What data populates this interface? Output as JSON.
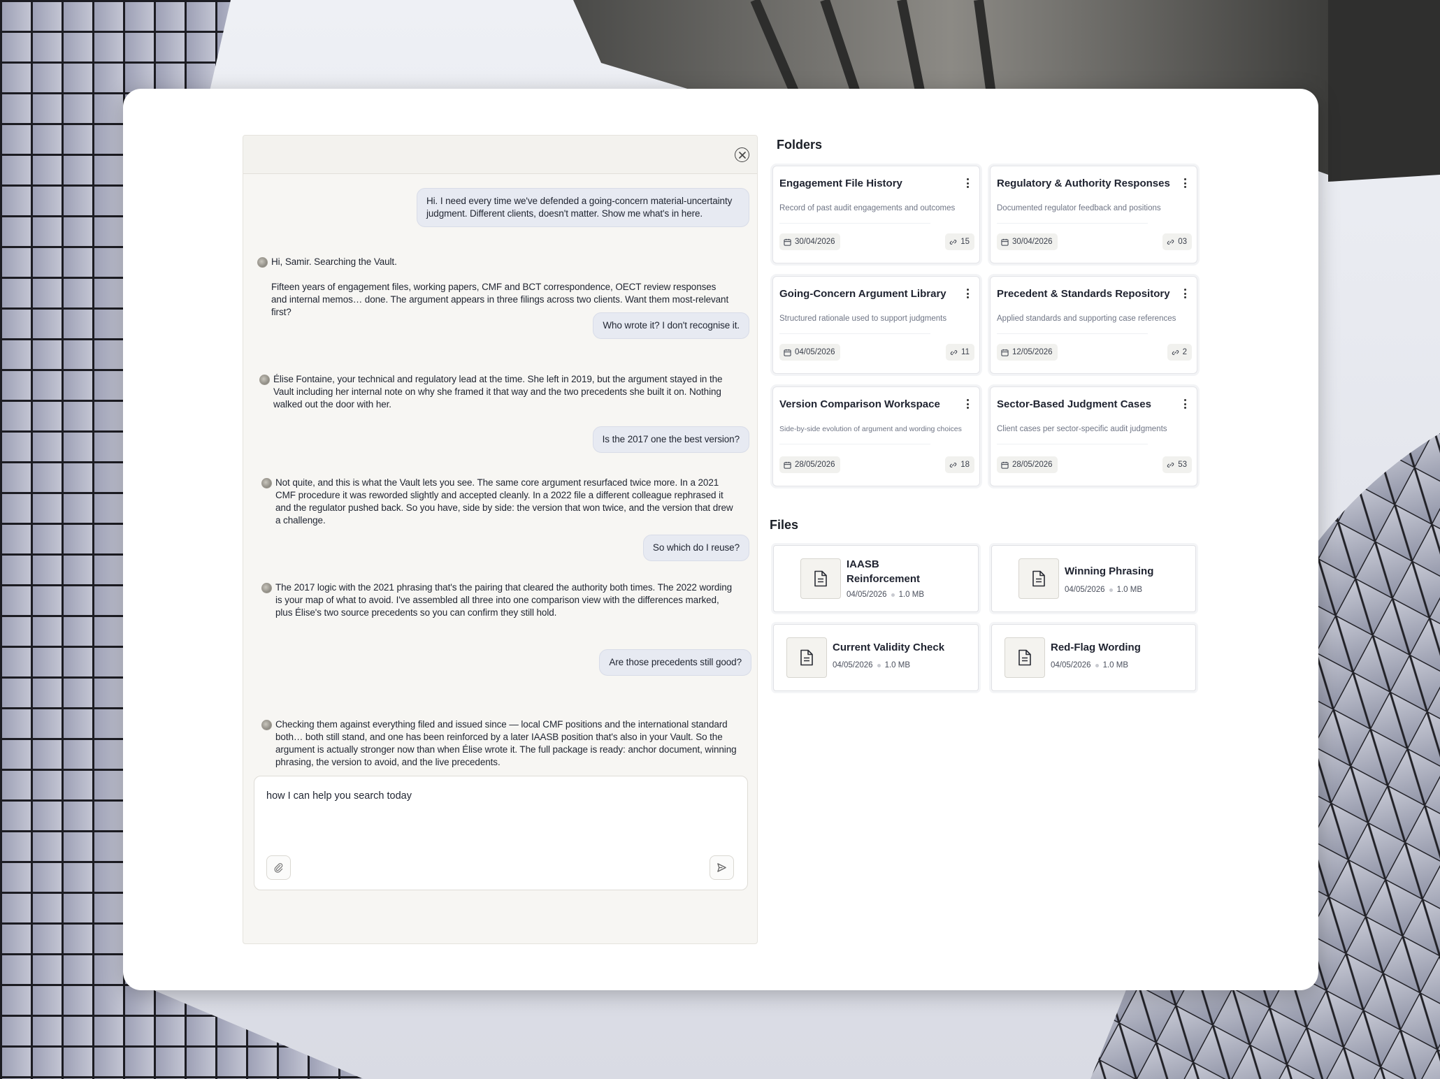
{
  "chat": {
    "messages": [
      {
        "role": "user",
        "text": "Hi. I need every time we've defended a going-concern material-uncertainty judgment. Different clients, doesn't matter. Show me what's in here."
      },
      {
        "role": "assistant",
        "paragraphs": [
          "Hi, Samir. Searching the Vault.",
          "Fifteen years of engagement files, working papers, CMF and BCT correspondence, OECT review responses and internal memos… done. The argument appears in three filings across two clients. Want them most-relevant first?"
        ]
      },
      {
        "role": "user",
        "text": "Who wrote it? I don't recognise it."
      },
      {
        "role": "assistant",
        "paragraphs": [
          "Élise Fontaine, your technical and regulatory lead at the time. She left in 2019, but the argument stayed in the Vault including her internal note on why she framed it that way and the two precedents she built it on. Nothing walked out the door with her."
        ]
      },
      {
        "role": "user",
        "text": "Is the 2017 one the best version?"
      },
      {
        "role": "assistant",
        "paragraphs": [
          "Not quite, and this is what the Vault lets you see. The same core argument resurfaced twice more. In a 2021 CMF procedure it was reworded slightly and accepted cleanly. In a 2022 file a different colleague rephrased it and the regulator pushed back. So you have, side by side: the version that won twice, and the version that drew a challenge."
        ]
      },
      {
        "role": "user",
        "text": "So which do I reuse?"
      },
      {
        "role": "assistant",
        "paragraphs": [
          "The 2017 logic with the 2021 phrasing  that's the pairing that cleared the authority both times. The 2022 wording is your map of what to avoid. I've assembled all three into one comparison view with the differences marked, plus Élise's two source precedents so you can confirm they still hold."
        ]
      },
      {
        "role": "user",
        "text": "Are those precedents still good?"
      },
      {
        "role": "assistant",
        "paragraphs": [
          "Checking them against everything filed and issued since — local CMF positions and the international standard both… both still stand, and one has been reinforced by a later IAASB position that's also in your Vault. So the argument is actually stronger now than when Élise wrote it. The full package is ready: anchor document, winning phrasing, the version to avoid, and the live precedents."
        ]
      }
    ],
    "composer": {
      "value": "how I can help you search today"
    }
  },
  "folders_title": "Folders",
  "folders": [
    {
      "title": "Engagement File History",
      "desc": "Record of past audit engagements and outcomes",
      "date": "30/04/2026",
      "count": "15"
    },
    {
      "title": "Regulatory & Authority Responses",
      "desc": "Documented regulator feedback and positions",
      "date": "30/04/2026",
      "count": "03"
    },
    {
      "title": "Going-Concern Argument Library",
      "desc": "Structured rationale used to support judgments",
      "date": "04/05/2026",
      "count": "11"
    },
    {
      "title": "Precedent & Standards Repository",
      "desc": "Applied standards and supporting case references",
      "date": "12/05/2026",
      "count": "2"
    },
    {
      "title": "Version Comparison Workspace",
      "desc": "Side-by-side evolution of argument and wording choices",
      "date": "28/05/2026",
      "count": "18"
    },
    {
      "title": "Sector-Based Judgment Cases",
      "desc": "Client cases per sector-specific audit judgments",
      "date": "28/05/2026",
      "count": "53"
    }
  ],
  "files_title": "Files",
  "files": [
    {
      "name": "IAASB Reinforcement",
      "date": "04/05/2026",
      "size": "1.0 MB"
    },
    {
      "name": "Winning Phrasing",
      "date": "04/05/2026",
      "size": "1.0 MB"
    },
    {
      "name": "Current Validity Check",
      "date": "04/05/2026",
      "size": "1.0 MB"
    },
    {
      "name": "Red-Flag Wording",
      "date": "04/05/2026",
      "size": "1.0 MB"
    }
  ]
}
